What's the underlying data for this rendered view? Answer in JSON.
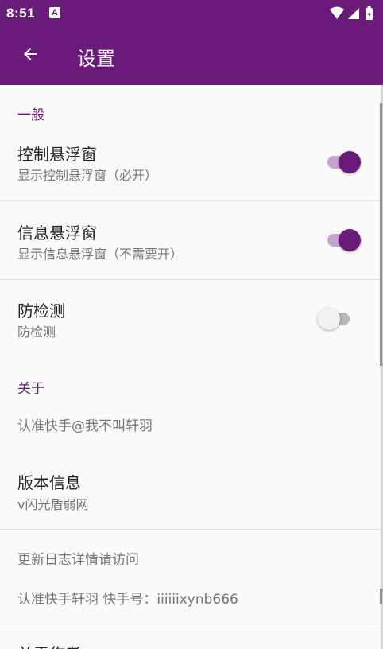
{
  "status_bar": {
    "time": "8:51",
    "notification_icon": "a-letter-icon",
    "icons": [
      "wifi-icon",
      "signal-icon",
      "battery-charging-icon"
    ]
  },
  "app_bar": {
    "title": "设置",
    "back_icon": "arrow-back-icon"
  },
  "colors": {
    "primary": "#6a1b7a",
    "switch_track_on": "#c9a1d0",
    "switch_off_track": "#b8b8b8"
  },
  "sections": {
    "general": {
      "header": "一般",
      "items": [
        {
          "title": "控制悬浮窗",
          "summary": "显示控制悬浮窗（必开）",
          "checked": true
        },
        {
          "title": "信息悬浮窗",
          "summary": "显示信息悬浮窗（不需要开）",
          "checked": true
        },
        {
          "title": "防检测",
          "summary": "防检测",
          "checked": false
        }
      ]
    },
    "about": {
      "header": "关于",
      "credit": "认准快手@我不叫轩羽",
      "version_title": "版本信息",
      "version_summary": "v闪光盾弱网",
      "changelog": "更新日志详情请访问",
      "contact": "认准快手轩羽 快手号：iiiiiixynb666",
      "author_title": "关于作者"
    }
  }
}
